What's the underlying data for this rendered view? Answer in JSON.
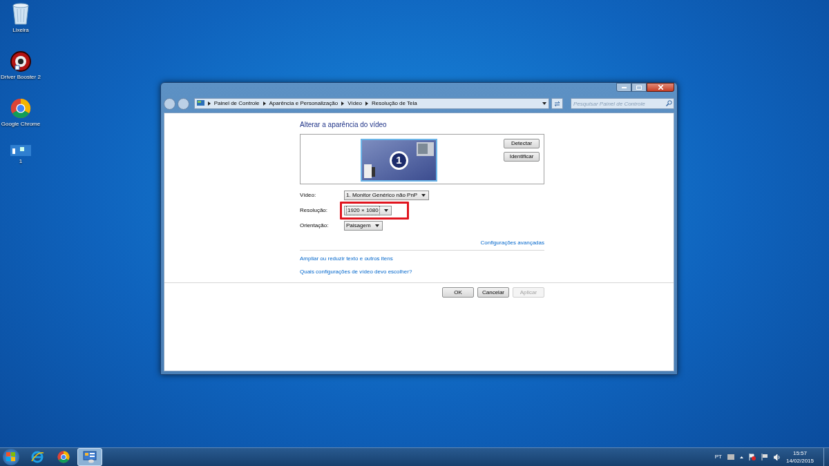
{
  "desktop_icons": [
    {
      "kind": "recycle-bin",
      "label": "Lixeira"
    },
    {
      "kind": "booster",
      "label": "Driver Booster 2"
    },
    {
      "kind": "chrome",
      "label": "Google Chrome"
    },
    {
      "kind": "window",
      "label": "1"
    }
  ],
  "window": {
    "breadcrumb": [
      "Painel de Controle",
      "Aparência e Personalização",
      "Vídeo",
      "Resolução de Tela"
    ],
    "search": {
      "placeholder": "Pesquisar Painel de Controle"
    },
    "heading": "Alterar a aparência do vídeo",
    "monitor_number": "1",
    "side_buttons": [
      "Detectar",
      "Identificar"
    ],
    "fields": [
      {
        "label": "Vídeo:",
        "value": "1. Monitor Genérico não PnP",
        "highlighted": false
      },
      {
        "label": "Resolução:",
        "value": "1920 × 1080",
        "highlighted": true
      },
      {
        "label": "Orientação:",
        "value": "Paisagem",
        "highlighted": false
      }
    ],
    "advanced_link": "Configurações avançadas",
    "links": [
      "Ampliar ou reduzir texto e outros itens",
      "Quais configurações de vídeo devo escolher?"
    ],
    "buttons": [
      {
        "label": "OK",
        "disabled": false
      },
      {
        "label": "Cancelar",
        "disabled": false
      },
      {
        "label": "Aplicar",
        "disabled": true
      }
    ]
  },
  "taskbar": {
    "apps": [
      {
        "kind": "ie",
        "selected": false
      },
      {
        "kind": "chrome",
        "selected": false
      },
      {
        "kind": "display",
        "selected": true
      }
    ],
    "language": "PT",
    "time": "15:57",
    "date": "14/02/2015"
  }
}
